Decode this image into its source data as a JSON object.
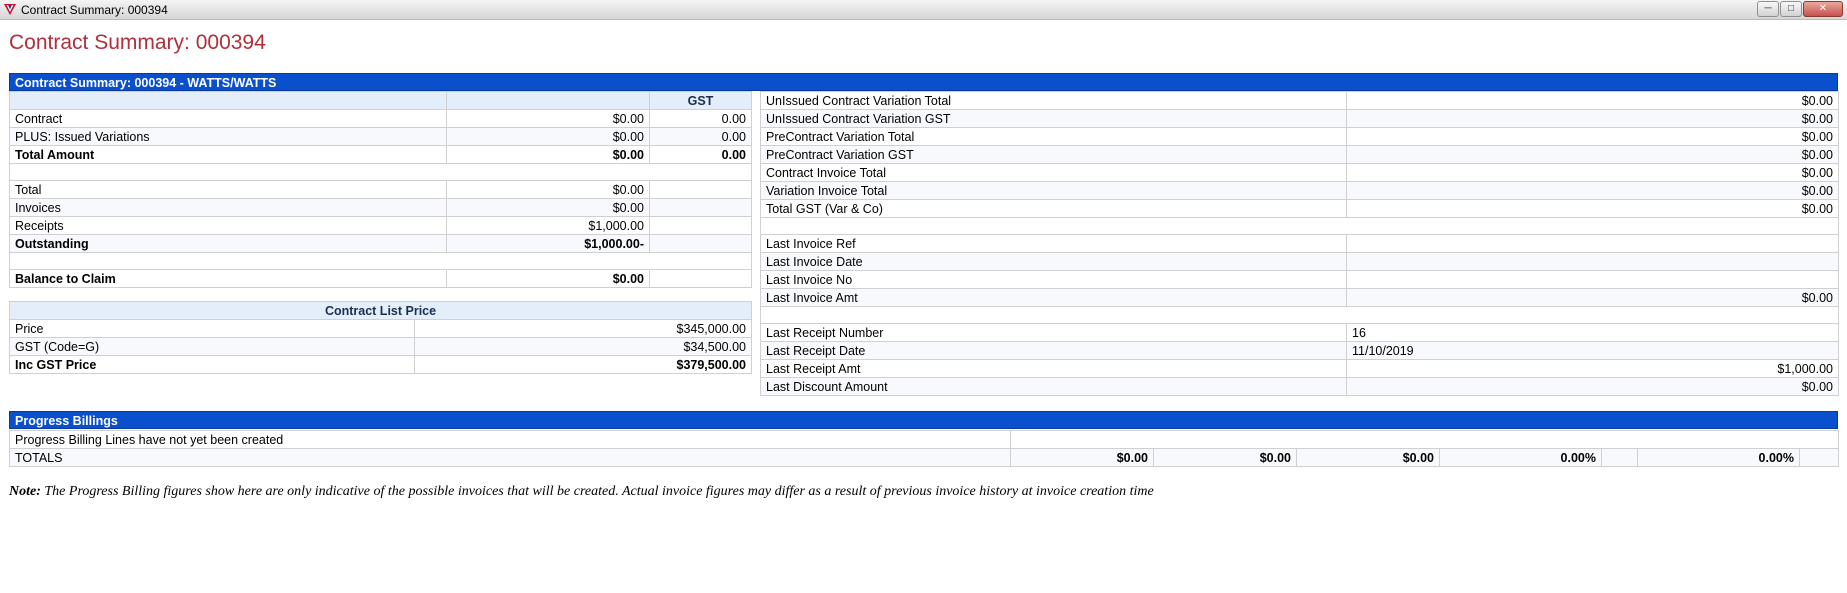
{
  "window": {
    "title": "Contract Summary: 000394"
  },
  "page_title": "Contract Summary: 000394",
  "summary_section": {
    "title": "Contract Summary: 000394 - WATTS/WATTS",
    "gst_header": "GST",
    "rows": [
      {
        "label": "Contract",
        "amount": "$0.00",
        "gst": "0.00"
      },
      {
        "label": "PLUS: Issued Variations",
        "amount": "$0.00",
        "gst": "0.00"
      },
      {
        "label": "Total Amount",
        "amount": "$0.00",
        "gst": "0.00"
      },
      {
        "label": "Total",
        "amount": "$0.00"
      },
      {
        "label": "Invoices",
        "amount": "$0.00"
      },
      {
        "label": "Receipts",
        "amount": "$1,000.00"
      },
      {
        "label": "Outstanding",
        "amount": "$1,000.00-"
      },
      {
        "label": "Balance to Claim",
        "amount": "$0.00"
      }
    ]
  },
  "list_price": {
    "title": "Contract List Price",
    "rows": [
      {
        "label": "Price",
        "value": "$345,000.00"
      },
      {
        "label": "GST (Code=G)",
        "value": "$34,500.00"
      },
      {
        "label": "Inc GST Price",
        "value": "$379,500.00"
      }
    ]
  },
  "right_panel": {
    "rows": [
      {
        "label": "UnIssued Contract Variation Total",
        "value": "$0.00"
      },
      {
        "label": "UnIssued Contract Variation GST",
        "value": "$0.00"
      },
      {
        "label": "PreContract Variation Total",
        "value": "$0.00"
      },
      {
        "label": "PreContract Variation GST",
        "value": "$0.00"
      },
      {
        "label": "Contract Invoice Total",
        "value": "$0.00"
      },
      {
        "label": "Variation Invoice Total",
        "value": "$0.00"
      },
      {
        "label": "Total GST (Var & Co)",
        "value": "$0.00"
      },
      {
        "label": "Last Invoice Ref",
        "value": ""
      },
      {
        "label": "Last Invoice Date",
        "value": ""
      },
      {
        "label": "Last Invoice No",
        "value": ""
      },
      {
        "label": "Last Invoice Amt",
        "value": "$0.00"
      },
      {
        "label": "Last Receipt Number",
        "value": "16"
      },
      {
        "label": "Last Receipt Date",
        "value": "11/10/2019"
      },
      {
        "label": "Last Receipt Amt",
        "value": "$1,000.00"
      },
      {
        "label": "Last Discount Amount",
        "value": "$0.00"
      }
    ]
  },
  "progress": {
    "title": "Progress Billings",
    "message": "Progress Billing Lines have not yet been created",
    "totals_label": "TOTALS",
    "totals": [
      "$0.00",
      "$0.00",
      "$0.00",
      "0.00%",
      "",
      "0.00%",
      ""
    ]
  },
  "note": {
    "label": "Note:",
    "text": "The Progress Billing figures show here are only indicative of the possible invoices that will be created. Actual invoice figures may differ as a result of previous invoice history at invoice creation time"
  }
}
